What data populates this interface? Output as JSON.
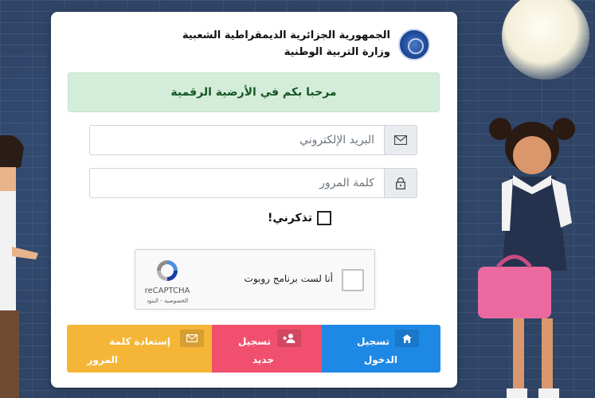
{
  "header": {
    "title_line1": "الجمهورية الجزائرية الديمقراطية الشعبية",
    "title_line2": "وزارة التربية الوطنية",
    "logo_icon": "ministry-emblem"
  },
  "alert": {
    "message": "مرحبا بكم في الأرضية الرقمية"
  },
  "form": {
    "email": {
      "placeholder": "البريد الإلكتروني",
      "value": "",
      "icon": "envelope-icon"
    },
    "password": {
      "placeholder": "كلمة المرور",
      "value": "",
      "icon": "lock-icon"
    },
    "remember_label": "تذكرني!",
    "remember_checked": false
  },
  "captcha": {
    "label": "أنا لست برنامج روبوت",
    "brand": "reCAPTCHA",
    "terms": "الخصوصية - البنود",
    "checked": false
  },
  "buttons": {
    "login": {
      "line1": "تسجيل",
      "line2": "الدخول",
      "icon": "home-icon",
      "color": "#1e88e5"
    },
    "register": {
      "line1": "تسجيل",
      "line2": "جديد",
      "icon": "user-plus-icon",
      "color": "#f0506e"
    },
    "recover": {
      "line1": "إستعادة كلمة",
      "line2": "المرور",
      "icon": "envelope-icon",
      "color": "#f5b638"
    }
  },
  "colors": {
    "alert_bg": "#d4edda",
    "alert_text": "#155724",
    "background": "#2f4466"
  }
}
